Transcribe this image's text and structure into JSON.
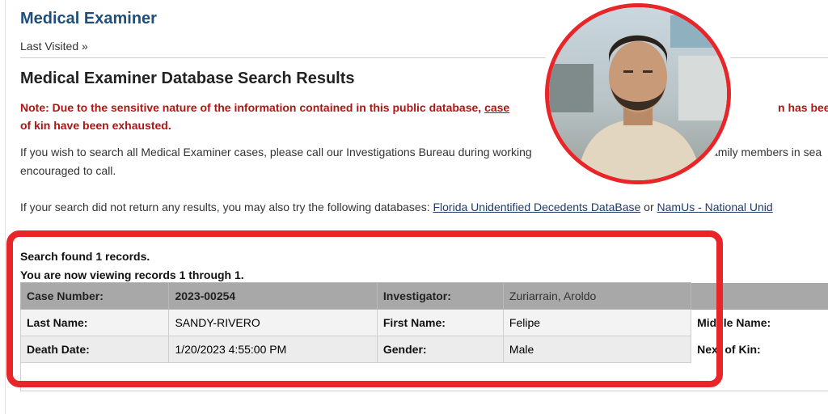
{
  "header": {
    "title": "Medical Examiner",
    "last_visited": "Last Visited »"
  },
  "page": {
    "heading": "Medical Examiner Database Search Results",
    "note_line1_prefix": "Note: Due to the sensitive nature of the information contained in this public database, ",
    "note_line1_underlined": "case",
    "note_line1_tail": "n has been notif",
    "note_line2": "of kin have been exhausted.",
    "info_line1_start": "If you wish to search all Medical Examiner cases, please call our Investigations Bureau during working",
    "info_line1_end": "amily members in sea",
    "info_line2": "encouraged to call.",
    "db_text": "If your search did not return any results, you may also try the following databases: ",
    "db_link1": "Florida Unidentified Decedents DataBase",
    "db_or": " or ",
    "db_link2": "NamUs - National Unid"
  },
  "results": {
    "found_text": "Search found 1 records.",
    "viewing_text": "You are now viewing records 1 through 1.",
    "rows": [
      {
        "l1": "Case Number:",
        "v1": "2023-00254",
        "l2": "Investigator:",
        "v2": "Zuriarrain, Aroldo",
        "l3": ""
      },
      {
        "l1": "Last Name:",
        "v1": "SANDY-RIVERO",
        "l2": "First Name:",
        "v2": "Felipe",
        "l3": "Middle Name:"
      },
      {
        "l1": "Death Date:",
        "v1": "1/20/2023 4:55:00 PM",
        "l2": "Gender:",
        "v2": "Male",
        "l3": "Next of Kin:"
      }
    ]
  },
  "overlay": {
    "highlight_color": "#e8262a",
    "photo_icon": "person-photo"
  }
}
